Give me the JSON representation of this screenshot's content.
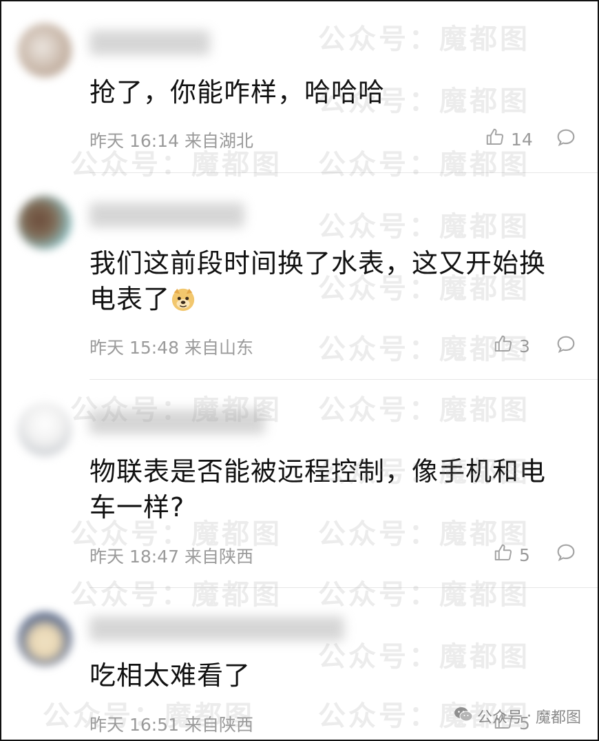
{
  "comments": [
    {
      "content_line1": "抢了，你能咋样，哈哈哈",
      "content_line2": "",
      "timestamp": "昨天 16:14",
      "location": "来自湖北",
      "likes": "14",
      "avatar_colors": [
        "#d9d3ce",
        "#b9a79a"
      ]
    },
    {
      "content_line1": "我们这前段时间换了水表，这又开始换",
      "content_line2": "电表了",
      "timestamp": "昨天 15:48",
      "location": "来自山东",
      "likes": "3",
      "avatar_colors": [
        "#8fc4c8",
        "#6b4b3a"
      ]
    },
    {
      "content_line1": "物联表是否能被远程控制，像手机和电",
      "content_line2": "车一样?",
      "timestamp": "昨天 18:47",
      "location": "来自陕西",
      "likes": "5",
      "avatar_colors": [
        "#f1f1f1",
        "#9aa0a6"
      ]
    },
    {
      "content_line1": "吃相太难看了",
      "content_line2": "",
      "timestamp": "昨天 16:51",
      "location": "来自陕西",
      "likes": "5",
      "avatar_colors": [
        "#e9d7b4",
        "#24324e"
      ]
    }
  ],
  "watermark": {
    "text": "公众号：魔都图",
    "badge_prefix": "公众号",
    "badge_name": "魔都图"
  },
  "icons": {
    "like": "thumbs-up-icon",
    "reply": "comment-bubble-icon",
    "emoji": "doge-emoji-icon",
    "badge": "wechat-icon"
  }
}
